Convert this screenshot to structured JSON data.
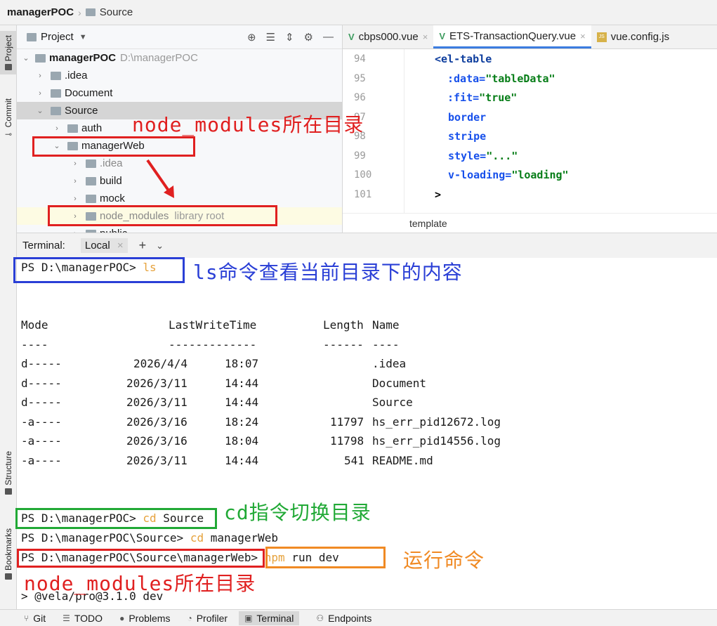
{
  "breadcrumb": {
    "project": "managerPOC",
    "folder": "Source"
  },
  "left_strip": {
    "project": "Project",
    "commit": "Commit",
    "structure": "Structure",
    "bookmarks": "Bookmarks"
  },
  "project_panel": {
    "title": "Project",
    "tree": [
      {
        "label": "managerPOC",
        "hint": "D:\\managerPOC",
        "arrow": "⌄",
        "bold": true
      },
      {
        "label": ".idea",
        "arrow": "›"
      },
      {
        "label": "Document",
        "arrow": "›"
      },
      {
        "label": "Source",
        "arrow": "⌄"
      },
      {
        "label": "auth",
        "arrow": "›"
      },
      {
        "label": "managerWeb",
        "arrow": "⌄"
      },
      {
        "label": ".idea",
        "arrow": "›"
      },
      {
        "label": "build",
        "arrow": "›"
      },
      {
        "label": "mock",
        "arrow": "›"
      },
      {
        "label": "node_modules",
        "hint": "library root",
        "arrow": "›"
      },
      {
        "label": "public",
        "arrow": "›"
      }
    ]
  },
  "editor": {
    "tabs": [
      {
        "label": "cbps000.vue"
      },
      {
        "label": "ETS-TransactionQuery.vue"
      },
      {
        "label": "vue.config.js"
      }
    ],
    "line_numbers": [
      "94",
      "95",
      "96",
      "97",
      "98",
      "99",
      "100",
      "101"
    ],
    "code": {
      "l94_tag": "<el-table",
      "l95_attr": ":data=",
      "l95_val": "\"tableData\"",
      "l96_attr": ":fit=",
      "l96_val": "\"true\"",
      "l97": "border",
      "l98": "stripe",
      "l99_attr": "style=",
      "l99_val": "\"...\"",
      "l100_attr": "v-loading=",
      "l100_val": "\"loading\"",
      "l101": ">"
    },
    "footer": "template"
  },
  "terminal": {
    "label": "Terminal:",
    "tab": "Local",
    "prompt1": "PS D:\\managerPOC> ",
    "cmd1": "ls",
    "header": {
      "mode": "Mode",
      "lwt": "LastWriteTime",
      "length": "Length",
      "name": "Name"
    },
    "under": {
      "mode": "----",
      "lwt": "-------------",
      "length": "------",
      "name": "----"
    },
    "rows": [
      {
        "mode": "d-----",
        "date": "2026/4/4",
        "time": "18:07",
        "length": "",
        "name": ".idea"
      },
      {
        "mode": "d-----",
        "date": "2026/3/11",
        "time": "14:44",
        "length": "",
        "name": "Document"
      },
      {
        "mode": "d-----",
        "date": "2026/3/11",
        "time": "14:44",
        "length": "",
        "name": "Source"
      },
      {
        "mode": "-a----",
        "date": "2026/3/16",
        "time": "18:24",
        "length": "11797",
        "name": "hs_err_pid12672.log"
      },
      {
        "mode": "-a----",
        "date": "2026/3/16",
        "time": "18:04",
        "length": "11798",
        "name": "hs_err_pid14556.log"
      },
      {
        "mode": "-a----",
        "date": "2026/3/11",
        "time": "14:44",
        "length": "541",
        "name": "README.md"
      }
    ],
    "prompt2": "PS D:\\managerPOC> ",
    "cmd2_kw": "cd",
    "cmd2_arg": " Source",
    "prompt3": "PS D:\\managerPOC\\Source> ",
    "cmd3_kw": "cd",
    "cmd3_arg": " managerWeb",
    "prompt4": "PS D:\\managerPOC\\Source\\managerWeb> ",
    "cmd4_kw": "npm",
    "cmd4_arg": " run dev",
    "output": "> @vela/pro@3.1.0 dev"
  },
  "annotations": {
    "node_modules_dir_top": "node_modules所在目录",
    "ls_note": "ls命令查看当前目录下的内容",
    "cd_note": "cd指令切换目录",
    "run_note": "运行命令",
    "node_modules_dir_bottom": "node_modules所在目录"
  },
  "annotation_colors": {
    "red": "#e02020",
    "blue": "#2a3fd6",
    "green": "#21a936",
    "orange": "#f08a24"
  },
  "status_bar": [
    {
      "label": "Git",
      "icon": "git-branch-icon"
    },
    {
      "label": "TODO",
      "icon": "list-icon"
    },
    {
      "label": "Problems",
      "icon": "problems-icon"
    },
    {
      "label": "Profiler",
      "icon": "profiler-icon"
    },
    {
      "label": "Terminal",
      "icon": "terminal-icon"
    },
    {
      "label": "Endpoints",
      "icon": "endpoints-icon"
    }
  ]
}
